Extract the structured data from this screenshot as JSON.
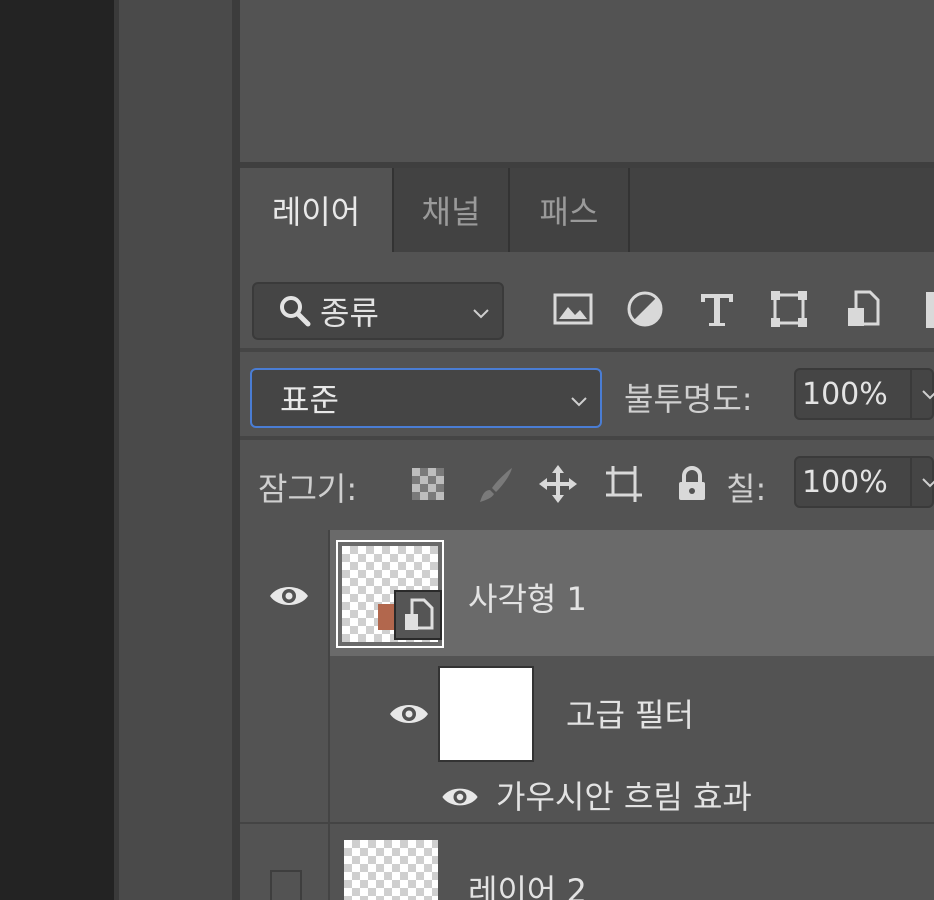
{
  "tabs": [
    {
      "label": "레이어",
      "active": true
    },
    {
      "label": "채널",
      "active": false
    },
    {
      "label": "패스",
      "active": false
    }
  ],
  "filter": {
    "kind_label": "종류",
    "icons": [
      "image-filter-icon",
      "adjustment-filter-icon",
      "type-filter-icon",
      "shape-filter-icon",
      "smart-object-filter-icon"
    ]
  },
  "blend": {
    "mode": "표준",
    "opacity_label": "불투명도:",
    "opacity_value": "100%"
  },
  "lock": {
    "label": "잠그기:",
    "fill_label": "칠:",
    "fill_value": "100%"
  },
  "layers": [
    {
      "name": "사각형 1",
      "selected": true
    },
    {
      "name": "고급 필터"
    },
    {
      "name": "가우시안 흐림 효과"
    },
    {
      "name": "레이어 2"
    }
  ],
  "colors": {
    "panel_bg": "#535353",
    "selected_row": "#6a6a6a",
    "focus_border": "#4a7dd4"
  }
}
